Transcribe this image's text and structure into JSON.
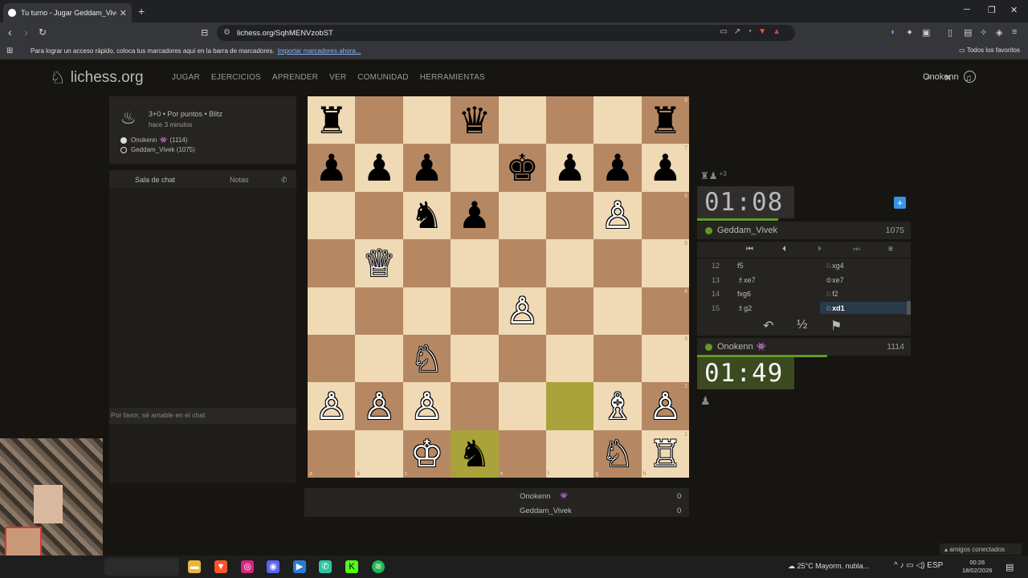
{
  "browser": {
    "tab_title": "Tu turno - Jugar Geddam_Vivek",
    "tab_close": "✕",
    "new_tab": "+",
    "url": "lichess.org/SqhMENVzobST",
    "bookmarks_text": "Para lograr un acceso rápido, coloca tus marcadores aquí en la barra de marcadores.",
    "bookmarks_link": "Importar marcadores ahora...",
    "all_bookmarks": "Todos los favoritos"
  },
  "header": {
    "logo": "lichess.org",
    "nav": [
      "JUGAR",
      "EJERCICIOS",
      "APRENDER",
      "VER",
      "COMUNIDAD",
      "HERRAMIENTAS"
    ],
    "username": "Onokenn"
  },
  "game_info": {
    "mode": "3+0 • Por puntos • Blitz",
    "started": "hace 3 minutos",
    "white_player": "Onokenn",
    "white_rating": "(1114)",
    "black_player": "Geddam_Vivek (1075)"
  },
  "chat": {
    "tab_chat": "Sala de chat",
    "tab_notes": "Notas",
    "placeholder": "Por favor, sé amable en el chat"
  },
  "board": {
    "files": [
      "a",
      "b",
      "c",
      "d",
      "e",
      "f",
      "g",
      "h"
    ],
    "ranks": [
      "8",
      "7",
      "6",
      "5",
      "4",
      "3",
      "2",
      "1"
    ],
    "pieces": [
      {
        "sq": "a8",
        "p": "♜",
        "c": "b"
      },
      {
        "sq": "d8",
        "p": "♛",
        "c": "b"
      },
      {
        "sq": "h8",
        "p": "♜",
        "c": "b"
      },
      {
        "sq": "a7",
        "p": "♟",
        "c": "b"
      },
      {
        "sq": "b7",
        "p": "♟",
        "c": "b"
      },
      {
        "sq": "c7",
        "p": "♟",
        "c": "b"
      },
      {
        "sq": "e7",
        "p": "♚",
        "c": "b"
      },
      {
        "sq": "f7",
        "p": "♟",
        "c": "b"
      },
      {
        "sq": "g7",
        "p": "♟",
        "c": "b"
      },
      {
        "sq": "h7",
        "p": "♟",
        "c": "b"
      },
      {
        "sq": "c6",
        "p": "♞",
        "c": "b"
      },
      {
        "sq": "d6",
        "p": "♟",
        "c": "b"
      },
      {
        "sq": "g6",
        "p": "♙",
        "c": "w"
      },
      {
        "sq": "b5",
        "p": "♕",
        "c": "w"
      },
      {
        "sq": "e4",
        "p": "♙",
        "c": "w"
      },
      {
        "sq": "c3",
        "p": "♘",
        "c": "w"
      },
      {
        "sq": "a2",
        "p": "♙",
        "c": "w"
      },
      {
        "sq": "b2",
        "p": "♙",
        "c": "w"
      },
      {
        "sq": "c2",
        "p": "♙",
        "c": "w"
      },
      {
        "sq": "g2",
        "p": "♗",
        "c": "w"
      },
      {
        "sq": "h2",
        "p": "♙",
        "c": "w"
      },
      {
        "sq": "c1",
        "p": "♔",
        "c": "w"
      },
      {
        "sq": "d1",
        "p": "♞",
        "c": "b"
      },
      {
        "sq": "g1",
        "p": "♘",
        "c": "w"
      },
      {
        "sq": "h1",
        "p": "♖",
        "c": "w"
      }
    ],
    "highlight": [
      "f2",
      "d1"
    ]
  },
  "score": {
    "p1_name": "Onokenn",
    "p1_score": "0",
    "p2_name": "Geddam_Vivek",
    "p2_score": "0"
  },
  "right_panel": {
    "material_plus": "+3",
    "top_clock": "01:08",
    "top_player": "Geddam_Vivek",
    "top_rating": "1075",
    "bottom_clock": "01:49",
    "bottom_player": "Onokenn",
    "bottom_rating": "1114",
    "moves": [
      {
        "n": "12",
        "w": "f5",
        "b": "♘xg4"
      },
      {
        "n": "13",
        "w": "♗xe7",
        "b": "♔xe7"
      },
      {
        "n": "14",
        "w": "fxg6",
        "b": "♘f2"
      },
      {
        "n": "15",
        "w": "♗g2",
        "b": "♘xd1"
      }
    ],
    "draw": "½"
  },
  "taskbar": {
    "temp": "25°C",
    "weather": "Mayorm. nubla...",
    "lang": "ESP",
    "time": "00:26",
    "date": "18/02/2026",
    "friends": "amigos conectados"
  },
  "colors": {
    "accent_green": "#629924",
    "board_light": "#f0d9b5",
    "board_dark": "#b58863"
  }
}
